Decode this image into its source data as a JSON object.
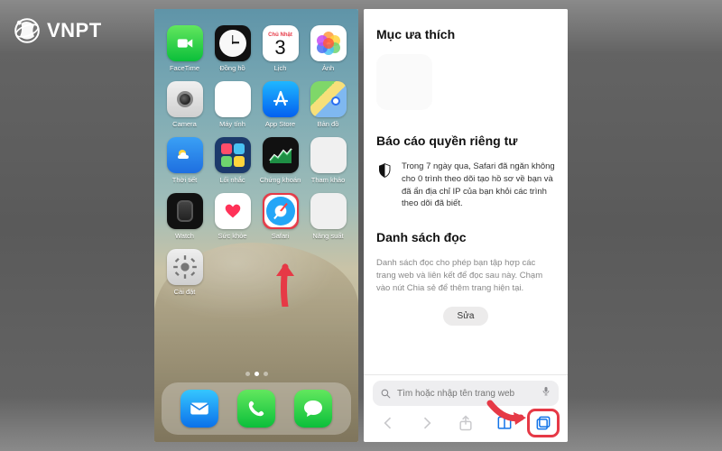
{
  "brand": {
    "name": "VNPT"
  },
  "home": {
    "apps": {
      "facetime": "FaceTime",
      "clock": "Đồng hồ",
      "calendar_day": "Chủ Nhật",
      "calendar_num": "3",
      "calendar": "Lịch",
      "photos": "Ảnh",
      "camera": "Camera",
      "calculator": "Máy tính",
      "appstore": "App Store",
      "maps": "Bản đồ",
      "weather": "Thời tiết",
      "shortcuts": "Lối nhắc",
      "stocks": "Chứng khoán",
      "tips": "Tham khảo",
      "watch": "Watch",
      "health": "Sức khỏe",
      "safari": "Safari",
      "productivity": "Năng suất",
      "settings": "Cài đặt"
    },
    "dock": {
      "mail": "Mail",
      "phone": "Phone",
      "messages": "Messages"
    }
  },
  "safari": {
    "favorites_heading": "Mục ưa thích",
    "privacy_heading": "Báo cáo quyền riêng tư",
    "privacy_body": "Trong 7 ngày qua, Safari đã ngăn không cho 0 trình theo dõi tạo hồ sơ về bạn và đã ẩn địa chỉ IP của bạn khỏi các trình theo dõi đã biết.",
    "readinglist_heading": "Danh sách đọc",
    "readinglist_body": "Danh sách đọc cho phép bạn tập hợp các trang web và liên kết để đọc sau này. Chạm vào nút Chia sẻ để thêm trang hiện tại.",
    "edit_button": "Sửa",
    "search_placeholder": "Tìm hoặc nhập tên trang web"
  }
}
